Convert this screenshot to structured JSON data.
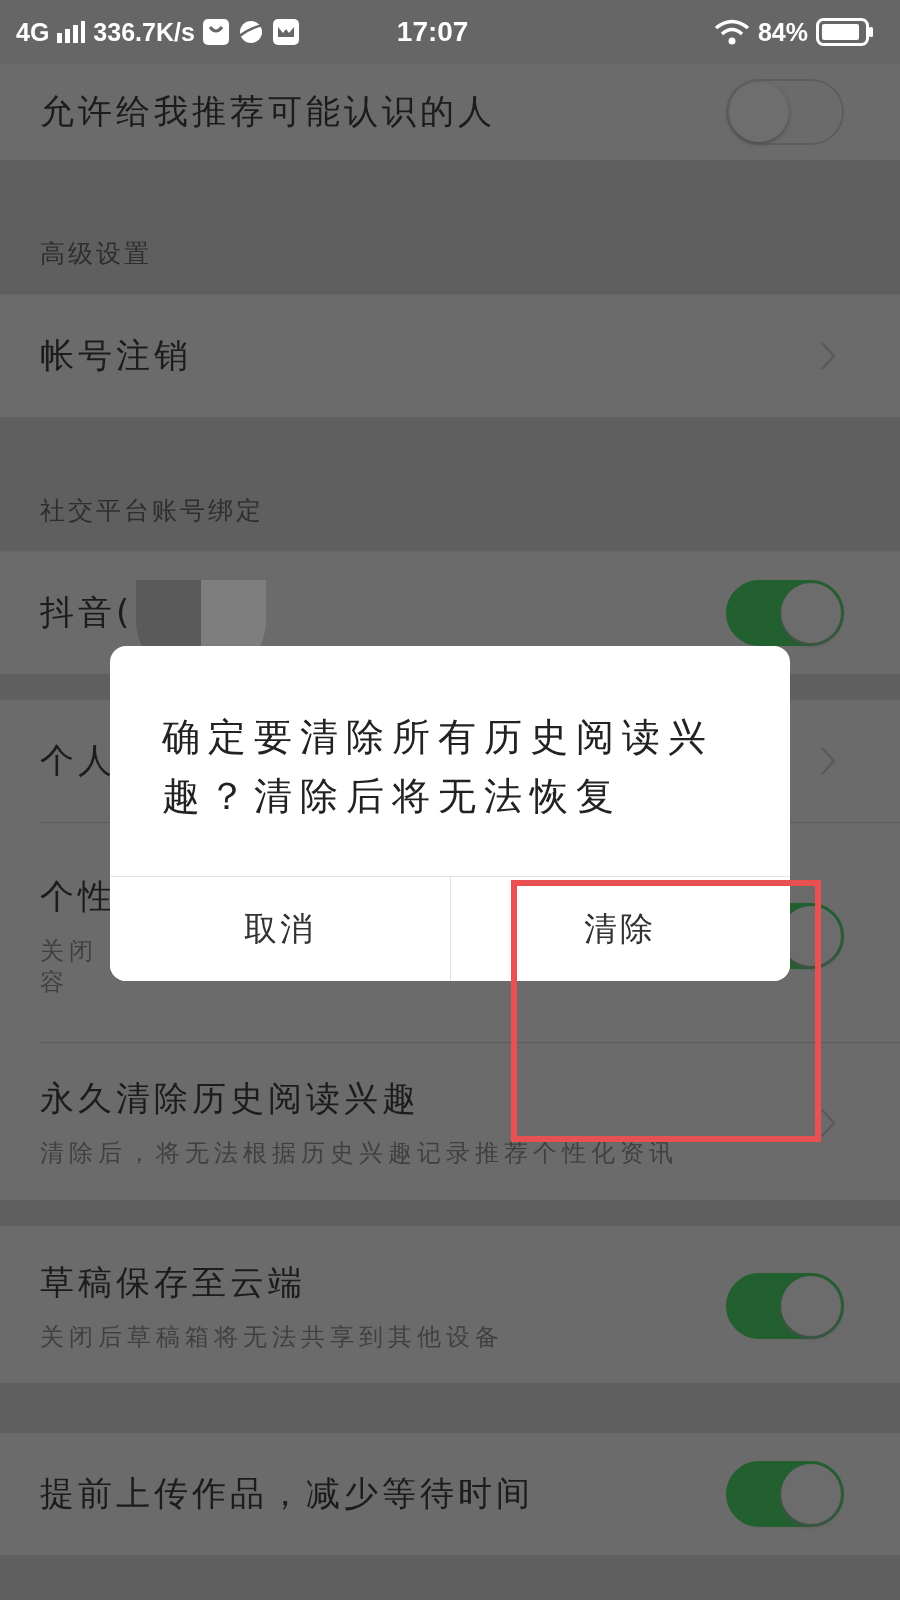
{
  "status_bar": {
    "network": "4G",
    "speed": "336.7K/s",
    "time": "17:07",
    "battery": "84%"
  },
  "settings": [
    {
      "kind": "row",
      "title": "允许给我推荐可能认识的人",
      "control": {
        "kind": "toggle",
        "on": false
      }
    },
    {
      "kind": "header",
      "title": "高级设置"
    },
    {
      "kind": "row",
      "title": "帐号注销",
      "control": {
        "kind": "chevron"
      }
    },
    {
      "kind": "header",
      "title": "社交平台账号绑定"
    },
    {
      "kind": "row",
      "title": "抖音(",
      "control": {
        "kind": "toggle",
        "on": true
      },
      "redacted": true
    },
    {
      "kind": "spacer"
    },
    {
      "kind": "row",
      "title": "个人",
      "control": {
        "kind": "chevron"
      }
    },
    {
      "kind": "row",
      "title": "个性",
      "subtitle_lines": [
        "关闭",
        "容"
      ],
      "control": {
        "kind": "toggle",
        "on": true
      },
      "divider": true
    },
    {
      "kind": "row",
      "title": "永久清除历史阅读兴趣",
      "subtitle_lines": [
        "清除后，将无法根据历史兴趣记录推荐个性化资讯"
      ],
      "control": {
        "kind": "chevron"
      },
      "divider": true
    },
    {
      "kind": "spacer"
    },
    {
      "kind": "row",
      "title": "草稿保存至云端",
      "subtitle_lines": [
        "关闭后草稿箱将无法共享到其他设备"
      ],
      "control": {
        "kind": "toggle",
        "on": true
      }
    },
    {
      "kind": "wide-spacer"
    },
    {
      "kind": "row",
      "title": "提前上传作品，减少等待时间",
      "control": {
        "kind": "toggle",
        "on": true
      }
    }
  ],
  "dialog": {
    "message": "确定要清除所有历史阅读兴趣？清除后将无法恢复",
    "buttons": [
      "取消",
      "清除"
    ]
  },
  "highlight": {
    "shown": true
  }
}
